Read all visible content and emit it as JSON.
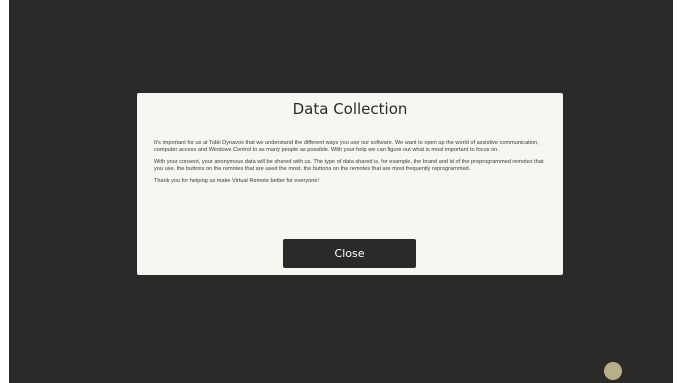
{
  "dialog": {
    "title": "Data Collection",
    "paragraphs": [
      "It's important for us at Tobii Dynavox that we understand the different ways you use our software. We want to open up the world of assistive communication, computer access and Windows Control to as many people as possible. With your help we can figure out what is most important to focus on.",
      "With your consent, your anonymous data will be shared with us. The type of data shared is, for example, the brand and id of the preprogrammed remotes that you use, the buttons on the remotes that are used the most, the buttons on the remotes that are most frequently reprogrammed.",
      "Thank you for helping us make Virtual Remote better for everyone!"
    ],
    "close_label": "Close"
  },
  "colors": {
    "background": "#2b2a28",
    "dialog": "#f8f6f0",
    "button": "#2b2a28",
    "indicator": "#b7ae8a"
  },
  "icons": {
    "corner_indicator": "circle-indicator-icon"
  }
}
